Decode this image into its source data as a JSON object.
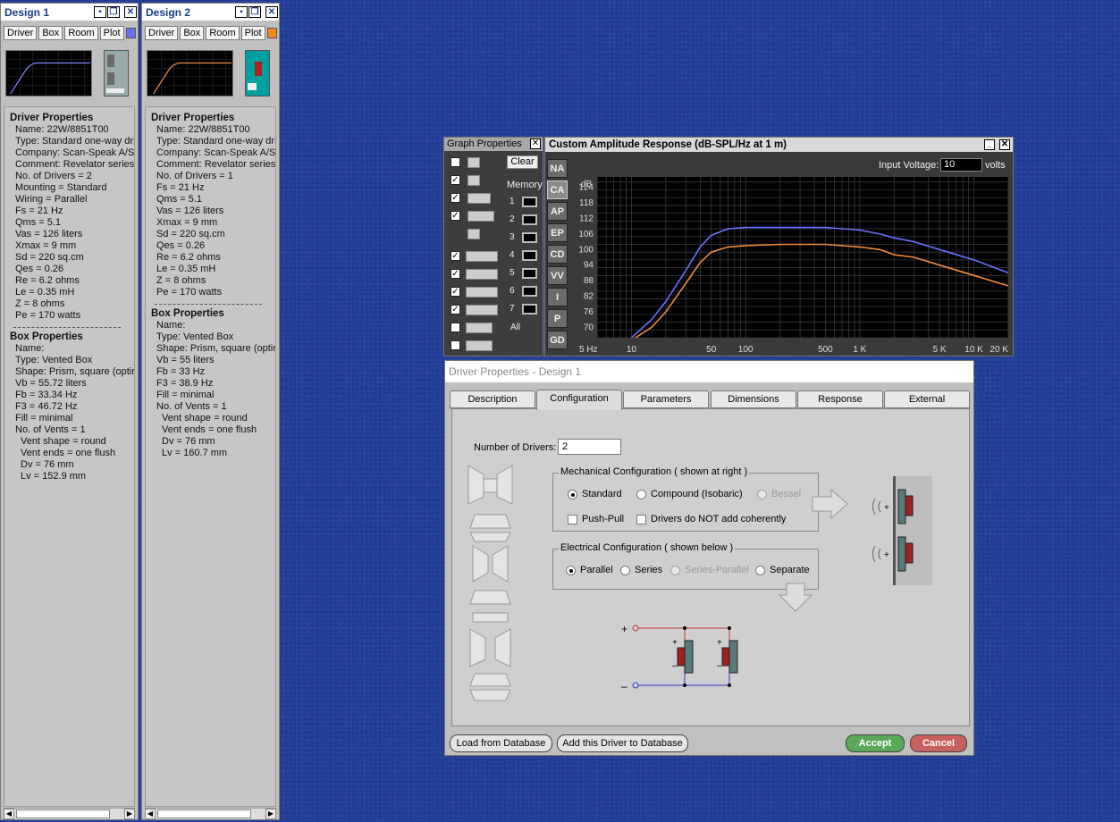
{
  "designs": [
    {
      "title": "Design 1",
      "tabs": [
        "Driver",
        "Box",
        "Room",
        "Plot"
      ],
      "plot_color": "#6b73f0",
      "driver": {
        "heading": "Driver Properties",
        "lines": [
          "Name: 22W/8851T00",
          "Type: Standard one-way driver",
          "Company: Scan-Speak A/S",
          "Comment: Revelator series",
          "No. of Drivers = 2",
          "Mounting = Standard",
          "Wiring = Parallel",
          "Fs =  21 Hz",
          "Qms =  5.1",
          "Vas =  126 liters",
          "Xmax =  9 mm",
          "Sd =  220 sq.cm",
          "Qes =  0.26",
          "Re =  6.2 ohms",
          "Le =  0.35 mH",
          "Z =  8 ohms",
          "Pe =  170 watts"
        ]
      },
      "box": {
        "heading": "Box Properties",
        "lines": [
          "Name:",
          "Type: Vented Box",
          "Shape: Prism, square (optimum)",
          "Vb =  55.72 liters",
          "Fb =  33.34 Hz",
          "F3 =  46.72 Hz",
          "Fill = minimal",
          "No. of Vents = 1"
        ],
        "vent_lines": [
          "Vent shape = round",
          "Vent ends = one flush",
          "Dv =  76 mm",
          "Lv =  152.9 mm"
        ]
      }
    },
    {
      "title": "Design 2",
      "tabs": [
        "Driver",
        "Box",
        "Room",
        "Plot"
      ],
      "plot_color": "#f08a20",
      "driver": {
        "heading": "Driver Properties",
        "lines": [
          "Name: 22W/8851T00",
          "Type: Standard one-way driver",
          "Company: Scan-Speak A/S",
          "Comment: Revelator series",
          "No. of Drivers = 1",
          "Fs =  21 Hz",
          "Qms =  5.1",
          "Vas =  126 liters",
          "Xmax =  9 mm",
          "Sd =  220 sq.cm",
          "Qes =  0.26",
          "Re =  6.2 ohms",
          "Le =  0.35 mH",
          "Z =  8 ohms",
          "Pe =  170 watts"
        ]
      },
      "box": {
        "heading": "Box Properties",
        "lines": [
          "Name:",
          "Type: Vented Box",
          "Shape: Prism, square (optimum)",
          "Vb =  55 liters",
          "Fb =  33 Hz",
          "F3 =  38.9 Hz",
          "Fill = minimal",
          "No. of Vents = 1"
        ],
        "vent_lines": [
          "Vent shape = round",
          "Vent ends = one flush",
          "Dv =  76 mm",
          "Lv =  160.7 mm"
        ]
      }
    }
  ],
  "graph_properties": {
    "title": "Graph Properties",
    "clear": "Clear",
    "memory": "Memory",
    "memory_slots": [
      "1",
      "2",
      "3",
      "4",
      "5",
      "6",
      "7"
    ],
    "all": "All",
    "checkbox_states": [
      false,
      true,
      true,
      true,
      true,
      true,
      true,
      true,
      false,
      false
    ]
  },
  "amplitude": {
    "title": "Custom Amplitude Response (dB-SPL/Hz at 1 m)",
    "input_voltage_label": "Input Voltage:",
    "input_voltage": "10",
    "volts": "volts",
    "side_buttons": [
      "NA",
      "CA",
      "AP",
      "EP",
      "CD",
      "VV",
      "I",
      "P",
      "GD"
    ],
    "active_button": "CA"
  },
  "chart_data": {
    "type": "line",
    "title": "Custom Amplitude Response (dB-SPL/Hz at 1 m)",
    "ylabel": "dB",
    "y_ticks": [
      124,
      118,
      112,
      106,
      100,
      94,
      88,
      82,
      76,
      70
    ],
    "x_ticks": [
      "5 Hz",
      "10",
      "50",
      "100",
      "500",
      "1 K",
      "5 K",
      "10 K",
      "20 K"
    ],
    "x_tick_values": [
      5,
      10,
      50,
      100,
      500,
      1000,
      5000,
      10000,
      20000
    ],
    "xlim": [
      5,
      20000
    ],
    "ylim": [
      66,
      128
    ],
    "x_scale": "log",
    "grid": true,
    "series": [
      {
        "color": "#6a72ff",
        "x": [
          10,
          15,
          20,
          30,
          40,
          50,
          70,
          100,
          200,
          500,
          1000,
          1500,
          2000,
          3000,
          5000,
          10000,
          20000
        ],
        "y": [
          66,
          73,
          80,
          92,
          101,
          105.5,
          108,
          108.5,
          108.5,
          108.5,
          107.5,
          106,
          104.5,
          103,
          100,
          96,
          91
        ]
      },
      {
        "color": "#f08a3a",
        "x": [
          10,
          15,
          20,
          30,
          40,
          50,
          70,
          100,
          200,
          500,
          1000,
          1500,
          2000,
          3000,
          5000,
          10000,
          20000
        ],
        "y": [
          65,
          70,
          76,
          87,
          95,
          99,
          101,
          101.5,
          102,
          102,
          101,
          100,
          98,
          97,
          94,
          90,
          86
        ]
      }
    ]
  },
  "driver_properties_dialog": {
    "title": "Driver Properties - Design 1",
    "tabs": [
      "Description",
      "Configuration",
      "Parameters",
      "Dimensions",
      "Response",
      "External"
    ],
    "active_tab": "Configuration",
    "num_drivers_label": "Number of Drivers:",
    "num_drivers": "2",
    "mech_title": "Mechanical Configuration  ( shown at right )",
    "mech_options": [
      "Standard",
      "Compound (Isobaric)",
      "Bessel"
    ],
    "mech_selected": "Standard",
    "push_pull": "Push-Pull",
    "not_coherent": "Drivers do NOT add coherently",
    "elec_title": "Electrical Configuration  ( shown below )",
    "elec_options": [
      "Parallel",
      "Series",
      "Series-Parallel",
      "Separate"
    ],
    "elec_selected": "Parallel",
    "plus": "+",
    "minus": "–",
    "load_btn": "Load from Database",
    "add_btn": "Add this Driver to Database",
    "accept": "Accept",
    "cancel": "Cancel",
    "accept_color": "#5aa85a",
    "cancel_color": "#c86060"
  }
}
